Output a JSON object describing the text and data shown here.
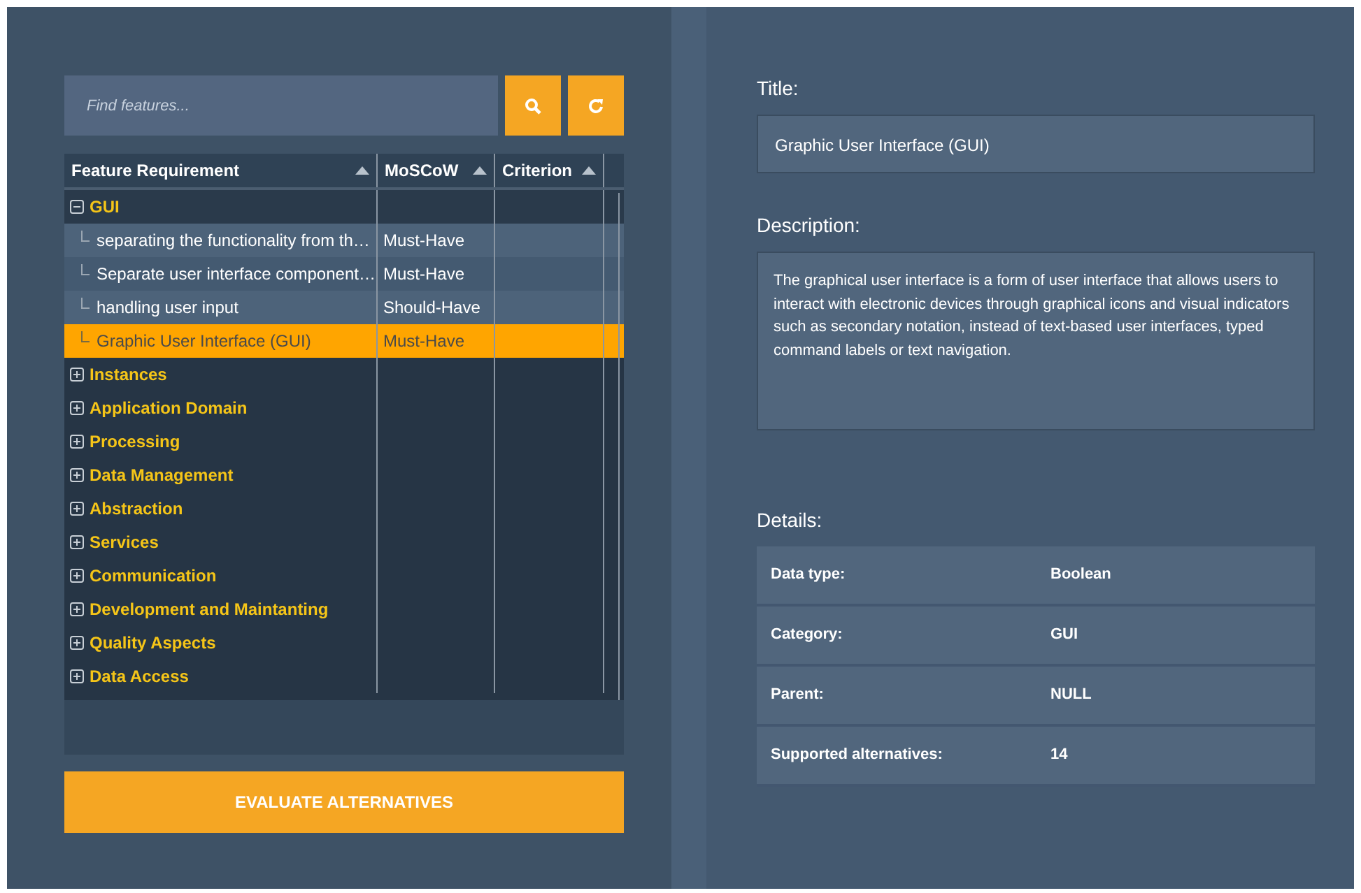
{
  "search": {
    "placeholder": "Find features..."
  },
  "table": {
    "columns": [
      "Feature Requirement",
      "MoSCoW",
      "Criterion"
    ],
    "groups": [
      {
        "label": "GUI",
        "expanded": true,
        "children": [
          {
            "label": "separating the functionality from th…",
            "moscow": "Must-Have",
            "selected": false
          },
          {
            "label": "Separate user interface component…",
            "moscow": "Must-Have",
            "selected": false
          },
          {
            "label": "handling user input",
            "moscow": "Should-Have",
            "selected": false
          },
          {
            "label": "Graphic User Interface (GUI)",
            "moscow": "Must-Have",
            "selected": true
          }
        ]
      },
      {
        "label": "Instances",
        "expanded": false
      },
      {
        "label": "Application Domain",
        "expanded": false
      },
      {
        "label": "Processing",
        "expanded": false
      },
      {
        "label": "Data Management",
        "expanded": false
      },
      {
        "label": "Abstraction",
        "expanded": false
      },
      {
        "label": "Services",
        "expanded": false
      },
      {
        "label": "Communication",
        "expanded": false
      },
      {
        "label": "Development and Maintanting",
        "expanded": false
      },
      {
        "label": "Quality Aspects",
        "expanded": false
      },
      {
        "label": "Data Access",
        "expanded": false
      }
    ]
  },
  "evaluate_button": "EVALUATE ALTERNATIVES",
  "title": {
    "label": "Title:",
    "value": "Graphic User Interface (GUI)"
  },
  "description": {
    "label": "Description:",
    "value": "The graphical user interface is a form of user interface that allows users to interact with electronic devices through graphical icons and visual indicators such as secondary notation, instead of text-based user interfaces, typed command labels or text navigation."
  },
  "details": {
    "label": "Details:",
    "rows": [
      {
        "key": "Data type:",
        "value": "Boolean"
      },
      {
        "key": "Category:",
        "value": "GUI"
      },
      {
        "key": "Parent:",
        "value": "NULL"
      },
      {
        "key": "Supported alternatives:",
        "value": "14"
      }
    ]
  }
}
